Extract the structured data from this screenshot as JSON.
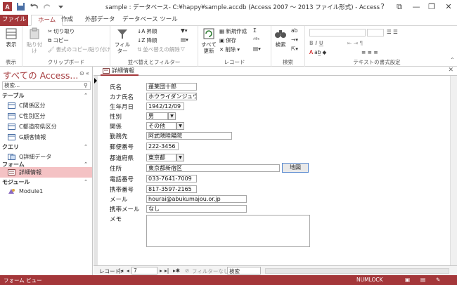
{
  "window": {
    "title": "sample : データベース- C:¥happy¥sample.accdb (Access 2007 ～ 2013 ファイル形式) - Access",
    "help": "?",
    "minimize": "—",
    "restore": "❐",
    "close": "✕"
  },
  "tabs": {
    "file": "ファイル",
    "home": "ホーム",
    "create": "作成",
    "external": "外部データ",
    "dbtools": "データベース ツール"
  },
  "ribbon": {
    "view_group": {
      "label": "表示",
      "view_button": "表示"
    },
    "clipboard": {
      "label": "クリップボード",
      "paste": "貼り付け",
      "cut": "切り取り",
      "copy": "コピー",
      "format_painter": "書式のコピー/貼り付け"
    },
    "sort_filter": {
      "label": "並べ替えとフィルター",
      "filter": "フィルター",
      "ascending": "昇順",
      "descending": "降順",
      "remove_sort": "並べ替えの解除"
    },
    "records": {
      "label": "レコード",
      "refresh": "すべて更新",
      "new": "新規作成",
      "save": "保存",
      "delete": "削除"
    },
    "find": {
      "label": "検索",
      "find": "検索"
    },
    "text_format": {
      "label": "テキストの書式設定"
    }
  },
  "nav": {
    "title": "すべての Access...",
    "search_placeholder": "検索...",
    "sections": {
      "tables": "テーブル",
      "queries": "クエリ",
      "forms": "フォーム",
      "modules": "モジュール"
    },
    "tables": [
      "C関係区分",
      "C性別区分",
      "C都道府県区分",
      "G顧客情報"
    ],
    "queries": [
      "Q詳細データ"
    ],
    "forms": [
      "詳細情報"
    ],
    "modules": [
      "Module1"
    ]
  },
  "document": {
    "tab_label": "詳細情報"
  },
  "form": {
    "labels": {
      "name": "氏名",
      "kana": "カナ氏名",
      "birth": "生年月日",
      "gender": "性別",
      "relation": "関係",
      "employer": "勤務先",
      "zip": "郵便番号",
      "pref": "都道府県",
      "address": "住所",
      "phone": "電話番号",
      "mobile": "携帯番号",
      "email": "メール",
      "mobile_email": "携帯メール",
      "memo": "メモ"
    },
    "values": {
      "name": "蓬莱団十郎",
      "kana": "ホウライダンジュウ",
      "birth": "1942/12/09",
      "gender": "男",
      "relation": "その他",
      "employer": "阿武隈陸陽院",
      "zip": "222-3456",
      "pref": "東京都",
      "address": "東京都新宿区",
      "phone": "033-7641-7009",
      "mobile": "817-3597-2165",
      "email": "hourai@abukumajou.or.jp",
      "mobile_email": "なし",
      "memo": ""
    },
    "map_button": "地図"
  },
  "record_nav": {
    "label": "レコード:",
    "current": "7",
    "filter_status": "フィルターなし",
    "search": "検索"
  },
  "status": {
    "mode": "フォーム ビュー",
    "numlock": "NUMLOCK"
  }
}
